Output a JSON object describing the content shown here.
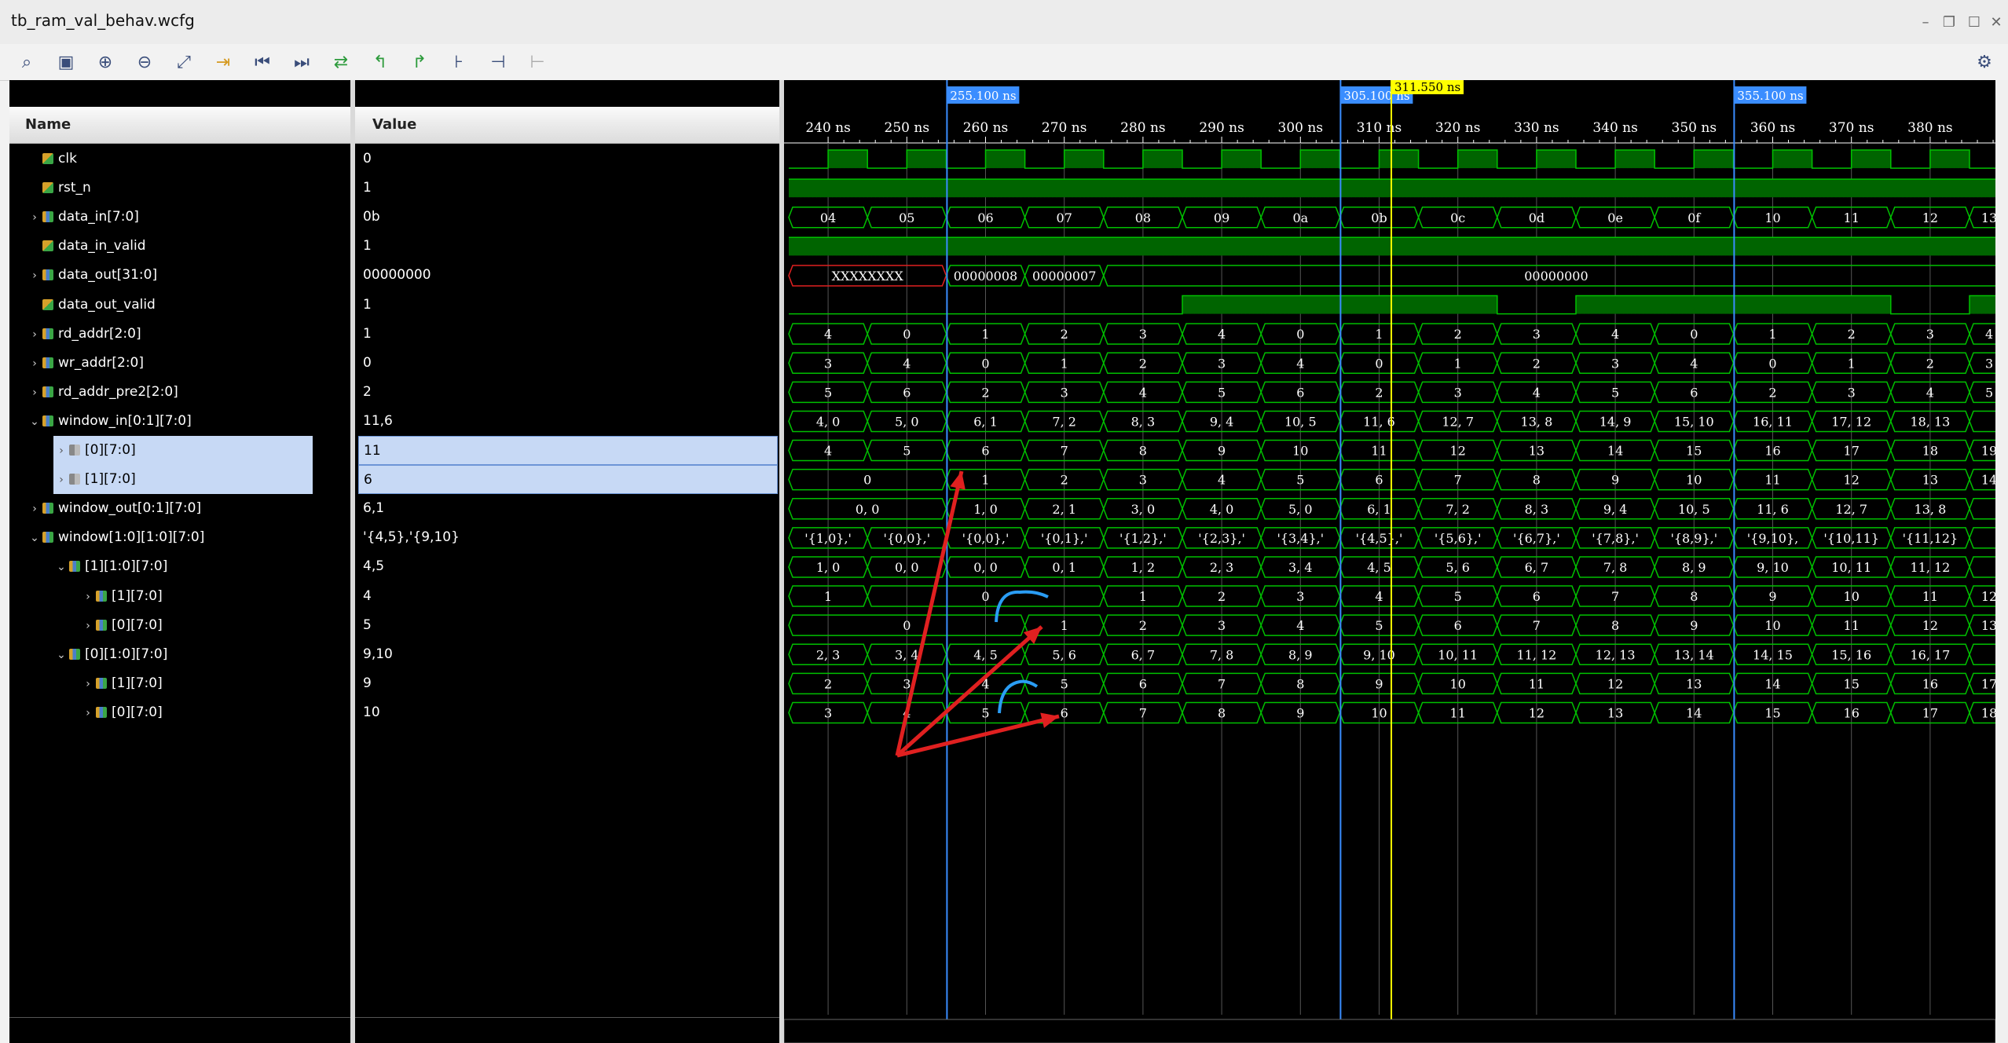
{
  "window": {
    "title": "tb_ram_val_behav.wcfg"
  },
  "toolbar": {
    "icons": [
      "search-icon",
      "save-icon",
      "zoom-in-icon",
      "zoom-out-icon",
      "zoom-fit-icon",
      "go-to-cursor-icon",
      "go-to-start-icon",
      "go-to-end-icon",
      "swap-cursors-icon",
      "previous-transition-icon",
      "next-transition-icon",
      "add-marker-icon",
      "previous-marker-icon",
      "next-marker-icon",
      "snap-to-transition-icon",
      "settings-icon"
    ]
  },
  "columns": {
    "name": "Name",
    "value": "Value"
  },
  "signals": [
    {
      "name": "clk",
      "value": "0",
      "indent": 0,
      "expand": "",
      "icon": "bit"
    },
    {
      "name": "rst_n",
      "value": "1",
      "indent": 0,
      "expand": "",
      "icon": "bit"
    },
    {
      "name": "data_in[7:0]",
      "value": "0b",
      "indent": 0,
      "expand": ">",
      "icon": "bus"
    },
    {
      "name": "data_in_valid",
      "value": "1",
      "indent": 0,
      "expand": "",
      "icon": "bit"
    },
    {
      "name": "data_out[31:0]",
      "value": "00000000",
      "indent": 0,
      "expand": ">",
      "icon": "bus"
    },
    {
      "name": "data_out_valid",
      "value": "1",
      "indent": 0,
      "expand": "",
      "icon": "bit"
    },
    {
      "name": "rd_addr[2:0]",
      "value": "1",
      "indent": 0,
      "expand": ">",
      "icon": "bus"
    },
    {
      "name": "wr_addr[2:0]",
      "value": "0",
      "indent": 0,
      "expand": ">",
      "icon": "bus"
    },
    {
      "name": "rd_addr_pre2[2:0]",
      "value": "2",
      "indent": 0,
      "expand": ">",
      "icon": "bus"
    },
    {
      "name": "window_in[0:1][7:0]",
      "value": "11,6",
      "indent": 0,
      "expand": "v",
      "icon": "bus"
    },
    {
      "name": "[0][7:0]",
      "value": "11",
      "indent": 1,
      "expand": ">",
      "icon": "sub",
      "selected": true
    },
    {
      "name": "[1][7:0]",
      "value": "6",
      "indent": 1,
      "expand": ">",
      "icon": "sub",
      "selected": true
    },
    {
      "name": "window_out[0:1][7:0]",
      "value": "6,1",
      "indent": 0,
      "expand": ">",
      "icon": "bus"
    },
    {
      "name": "window[1:0][1:0][7:0]",
      "value": "'{4,5},'{9,10}",
      "indent": 0,
      "expand": "v",
      "icon": "bus"
    },
    {
      "name": "[1][1:0][7:0]",
      "value": "4,5",
      "indent": 1,
      "expand": "v",
      "icon": "bus"
    },
    {
      "name": "[1][7:0]",
      "value": "4",
      "indent": 2,
      "expand": ">",
      "icon": "bus"
    },
    {
      "name": "[0][7:0]",
      "value": "5",
      "indent": 2,
      "expand": ">",
      "icon": "bus"
    },
    {
      "name": "[0][1:0][7:0]",
      "value": "9,10",
      "indent": 1,
      "expand": "v",
      "icon": "bus"
    },
    {
      "name": "[1][7:0]",
      "value": "9",
      "indent": 2,
      "expand": ">",
      "icon": "bus"
    },
    {
      "name": "[0][7:0]",
      "value": "10",
      "indent": 2,
      "expand": ">",
      "icon": "bus"
    }
  ],
  "time_axis": {
    "labels": [
      "240 ns",
      "250 ns",
      "260 ns",
      "270 ns",
      "280 ns",
      "290 ns",
      "300 ns",
      "310 ns",
      "320 ns",
      "330 ns",
      "340 ns",
      "350 ns",
      "360 ns",
      "370 ns",
      "380 ns"
    ]
  },
  "markers": [
    {
      "label": "255.100 ns",
      "time": 255.1
    },
    {
      "label": "305.100 ns",
      "time": 305.1
    },
    {
      "label": "355.100 ns",
      "time": 355.1
    }
  ],
  "cursor": {
    "label": "311.550 ns",
    "time": 311.55
  },
  "waves": {
    "data_in": [
      "04",
      "05",
      "06",
      "07",
      "08",
      "09",
      "0a",
      "0b",
      "0c",
      "0d",
      "0e",
      "0f",
      "10",
      "11",
      "12",
      "13"
    ],
    "data_out": [
      {
        "start": 235,
        "end": 255,
        "v": "XXXXXXXX"
      },
      {
        "start": 255,
        "end": 265,
        "v": "00000008"
      },
      {
        "start": 265,
        "end": 275,
        "v": "00000007"
      },
      {
        "start": 275,
        "end": 390,
        "v": "00000000"
      }
    ],
    "rd_addr": [
      "4",
      "0",
      "1",
      "2",
      "3",
      "4",
      "0",
      "1",
      "2",
      "3",
      "4",
      "0",
      "1",
      "2",
      "3",
      "4"
    ],
    "wr_addr": [
      "3",
      "4",
      "0",
      "1",
      "2",
      "3",
      "4",
      "0",
      "1",
      "2",
      "3",
      "4",
      "0",
      "1",
      "2",
      "3"
    ],
    "rd_addr_pre2": [
      "5",
      "6",
      "2",
      "3",
      "4",
      "5",
      "6",
      "2",
      "3",
      "4",
      "5",
      "6",
      "2",
      "3",
      "4",
      "5"
    ],
    "window_in": [
      "4, 0",
      "5, 0",
      "6, 1",
      "7, 2",
      "8, 3",
      "9, 4",
      "10, 5",
      "11, 6",
      "12, 7",
      "13, 8",
      "14, 9",
      "15, 10",
      "16, 11",
      "17, 12",
      "18, 13",
      ""
    ],
    "window_in_0": [
      "4",
      "5",
      "6",
      "7",
      "8",
      "9",
      "10",
      "11",
      "12",
      "13",
      "14",
      "15",
      "16",
      "17",
      "18",
      "19"
    ],
    "window_in_1": [
      {
        "start": 235,
        "end": 255,
        "v": "0"
      },
      {
        "start": 255,
        "end": 265,
        "v": "1"
      },
      {
        "start": 265,
        "end": 275,
        "v": "2"
      },
      {
        "start": 275,
        "end": 285,
        "v": "3"
      },
      {
        "start": 285,
        "end": 295,
        "v": "4"
      },
      {
        "start": 295,
        "end": 305,
        "v": "5"
      },
      {
        "start": 305,
        "end": 315,
        "v": "6"
      },
      {
        "start": 315,
        "end": 325,
        "v": "7"
      },
      {
        "start": 325,
        "end": 335,
        "v": "8"
      },
      {
        "start": 335,
        "end": 345,
        "v": "9"
      },
      {
        "start": 345,
        "end": 355,
        "v": "10"
      },
      {
        "start": 355,
        "end": 365,
        "v": "11"
      },
      {
        "start": 365,
        "end": 375,
        "v": "12"
      },
      {
        "start": 375,
        "end": 385,
        "v": "13"
      },
      {
        "start": 385,
        "end": 390,
        "v": "14"
      }
    ],
    "window_out": [
      {
        "start": 235,
        "end": 255,
        "v": "0, 0"
      },
      {
        "start": 255,
        "end": 265,
        "v": "1, 0"
      },
      {
        "start": 265,
        "end": 275,
        "v": "2, 1"
      },
      {
        "start": 275,
        "end": 285,
        "v": "3, 0"
      },
      {
        "start": 285,
        "end": 295,
        "v": "4, 0"
      },
      {
        "start": 295,
        "end": 305,
        "v": "5, 0"
      },
      {
        "start": 305,
        "end": 315,
        "v": "6, 1"
      },
      {
        "start": 315,
        "end": 325,
        "v": "7, 2"
      },
      {
        "start": 325,
        "end": 335,
        "v": "8, 3"
      },
      {
        "start": 335,
        "end": 345,
        "v": "9, 4"
      },
      {
        "start": 345,
        "end": 355,
        "v": "10, 5"
      },
      {
        "start": 355,
        "end": 365,
        "v": "11, 6"
      },
      {
        "start": 365,
        "end": 375,
        "v": "12, 7"
      },
      {
        "start": 375,
        "end": 385,
        "v": "13, 8"
      },
      {
        "start": 385,
        "end": 390,
        "v": ""
      }
    ],
    "window": [
      "'{1,0},'",
      "'{0,0},'",
      "'{0,0},'",
      "'{0,1},'",
      "'{1,2},'",
      "'{2,3},'",
      "'{3,4},'",
      "'{4,5},'",
      "'{5,6},'",
      "'{6,7},'",
      "'{7,8},'",
      "'{8,9},'",
      "'{9,10},",
      "'{10,11}",
      "'{11,12}",
      ""
    ],
    "window_1": [
      "1, 0",
      "0, 0",
      "0, 0",
      "0, 1",
      "1, 2",
      "2, 3",
      "3, 4",
      "4, 5",
      "5, 6",
      "6, 7",
      "7, 8",
      "8, 9",
      "9, 10",
      "10, 11",
      "11, 12",
      ""
    ],
    "window_1_1": [
      {
        "start": 235,
        "end": 245,
        "v": "1"
      },
      {
        "start": 245,
        "end": 275,
        "v": "0"
      },
      {
        "start": 275,
        "end": 285,
        "v": "1"
      },
      {
        "start": 285,
        "end": 295,
        "v": "2"
      },
      {
        "start": 295,
        "end": 305,
        "v": "3"
      },
      {
        "start": 305,
        "end": 315,
        "v": "4"
      },
      {
        "start": 315,
        "end": 325,
        "v": "5"
      },
      {
        "start": 325,
        "end": 335,
        "v": "6"
      },
      {
        "start": 335,
        "end": 345,
        "v": "7"
      },
      {
        "start": 345,
        "end": 355,
        "v": "8"
      },
      {
        "start": 355,
        "end": 365,
        "v": "9"
      },
      {
        "start": 365,
        "end": 375,
        "v": "10"
      },
      {
        "start": 375,
        "end": 385,
        "v": "11"
      },
      {
        "start": 385,
        "end": 390,
        "v": "12"
      }
    ],
    "window_1_0": [
      {
        "start": 235,
        "end": 265,
        "v": "0"
      },
      {
        "start": 265,
        "end": 275,
        "v": "1"
      },
      {
        "start": 275,
        "end": 285,
        "v": "2"
      },
      {
        "start": 285,
        "end": 295,
        "v": "3"
      },
      {
        "start": 295,
        "end": 305,
        "v": "4"
      },
      {
        "start": 305,
        "end": 315,
        "v": "5"
      },
      {
        "start": 315,
        "end": 325,
        "v": "6"
      },
      {
        "start": 325,
        "end": 335,
        "v": "7"
      },
      {
        "start": 335,
        "end": 345,
        "v": "8"
      },
      {
        "start": 345,
        "end": 355,
        "v": "9"
      },
      {
        "start": 355,
        "end": 365,
        "v": "10"
      },
      {
        "start": 365,
        "end": 375,
        "v": "11"
      },
      {
        "start": 375,
        "end": 385,
        "v": "12"
      },
      {
        "start": 385,
        "end": 390,
        "v": "13"
      }
    ],
    "window_0": [
      "2, 3",
      "3, 4",
      "4, 5",
      "5, 6",
      "6, 7",
      "7, 8",
      "8, 9",
      "9, 10",
      "10, 11",
      "11, 12",
      "12, 13",
      "13, 14",
      "14, 15",
      "15, 16",
      "16, 17",
      ""
    ],
    "window_0_1": [
      "2",
      "3",
      "4",
      "5",
      "6",
      "7",
      "8",
      "9",
      "10",
      "11",
      "12",
      "13",
      "14",
      "15",
      "16",
      "17"
    ],
    "window_0_0": [
      "3",
      "4",
      "5",
      "6",
      "7",
      "8",
      "9",
      "10",
      "11",
      "12",
      "13",
      "14",
      "15",
      "16",
      "17",
      "18"
    ]
  },
  "colors": {
    "wave": "#00c000",
    "fill": "#006400",
    "marker": "#3a8dff",
    "cursor": "#ffff00",
    "annotation_red": "#e02020",
    "annotation_blue": "#2a9df4"
  }
}
